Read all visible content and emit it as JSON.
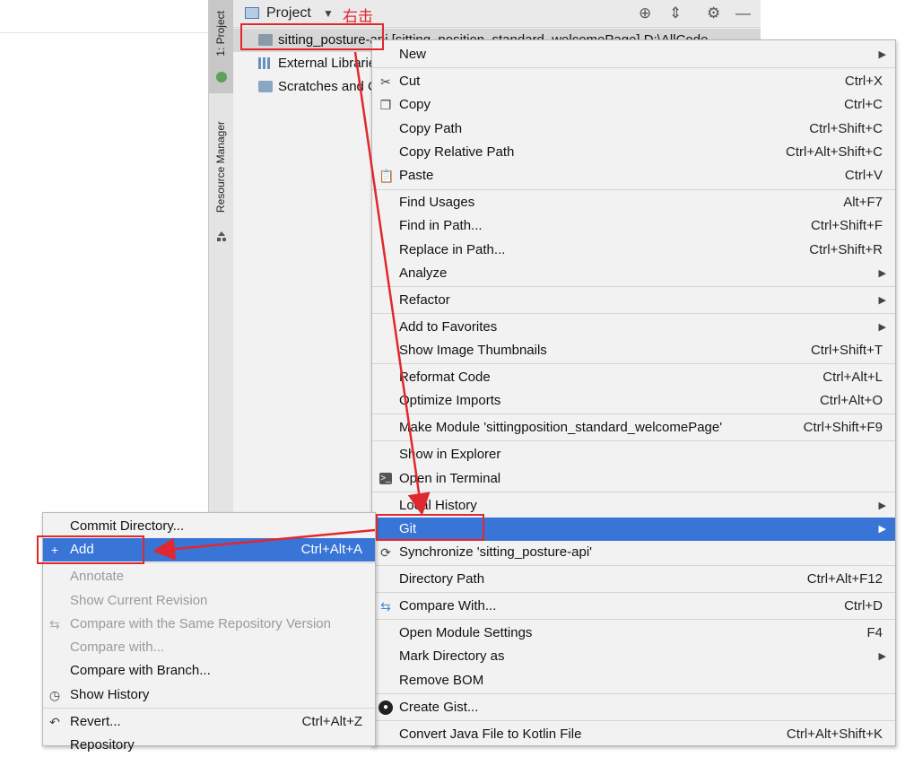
{
  "tool_strip": {
    "project_tab": "1: Project",
    "resource_tab": "Resource Manager"
  },
  "project_panel": {
    "title": "Project",
    "annotation": "右击",
    "tree": [
      {
        "label": "sitting_posture-api [sitting_position_standard_welcomePage]  D:\\AllCode",
        "icon": "module-folder-icon"
      },
      {
        "label": "External Libraries",
        "icon": "library-icon"
      },
      {
        "label": "Scratches and Consoles",
        "icon": "scratches-icon"
      }
    ]
  },
  "context_menu": {
    "items": [
      {
        "label": "New",
        "submenu": true
      },
      {
        "label": "Cut",
        "shortcut": "Ctrl+X",
        "icon": "scissors-icon"
      },
      {
        "label": "Copy",
        "shortcut": "Ctrl+C",
        "icon": "copy-icon"
      },
      {
        "label": "Copy Path",
        "shortcut": "Ctrl+Shift+C"
      },
      {
        "label": "Copy Relative Path",
        "shortcut": "Ctrl+Alt+Shift+C"
      },
      {
        "label": "Paste",
        "shortcut": "Ctrl+V",
        "icon": "paste-icon"
      },
      {
        "label": "Find Usages",
        "shortcut": "Alt+F7"
      },
      {
        "label": "Find in Path...",
        "shortcut": "Ctrl+Shift+F"
      },
      {
        "label": "Replace in Path...",
        "shortcut": "Ctrl+Shift+R"
      },
      {
        "label": "Analyze",
        "submenu": true
      },
      {
        "label": "Refactor",
        "submenu": true
      },
      {
        "label": "Add to Favorites",
        "submenu": true
      },
      {
        "label": "Show Image Thumbnails",
        "shortcut": "Ctrl+Shift+T"
      },
      {
        "label": "Reformat Code",
        "shortcut": "Ctrl+Alt+L"
      },
      {
        "label": "Optimize Imports",
        "shortcut": "Ctrl+Alt+O"
      },
      {
        "label": "Make Module 'sittingposition_standard_welcomePage'",
        "shortcut": "Ctrl+Shift+F9"
      },
      {
        "label": "Show in Explorer"
      },
      {
        "label": "Open in Terminal",
        "icon": "terminal-icon"
      },
      {
        "label": "Local History",
        "submenu": true
      },
      {
        "label": "Git",
        "submenu": true,
        "selected": true
      },
      {
        "label": "Synchronize 'sitting_posture-api'",
        "icon": "sync-icon"
      },
      {
        "label": "Directory Path",
        "shortcut": "Ctrl+Alt+F12"
      },
      {
        "label": "Compare With...",
        "shortcut": "Ctrl+D",
        "icon": "compare-icon"
      },
      {
        "label": "Open Module Settings",
        "shortcut": "F4"
      },
      {
        "label": "Mark Directory as",
        "submenu": true
      },
      {
        "label": "Remove BOM"
      },
      {
        "label": "Create Gist...",
        "icon": "github-icon"
      },
      {
        "label": "Convert Java File to Kotlin File",
        "shortcut": "Ctrl+Alt+Shift+K"
      }
    ]
  },
  "git_submenu": {
    "items": [
      {
        "label": "Commit Directory..."
      },
      {
        "label": "Add",
        "shortcut": "Ctrl+Alt+A",
        "selected": true,
        "icon": "plus-icon"
      },
      {
        "label": "Annotate",
        "disabled": true
      },
      {
        "label": "Show Current Revision",
        "disabled": true
      },
      {
        "label": "Compare with the Same Repository Version",
        "disabled": true,
        "icon": "compare-icon"
      },
      {
        "label": "Compare with...",
        "disabled": true
      },
      {
        "label": "Compare with Branch..."
      },
      {
        "label": "Show History",
        "icon": "clock-icon"
      },
      {
        "label": "Revert...",
        "shortcut": "Ctrl+Alt+Z",
        "icon": "revert-icon"
      },
      {
        "label": "Repository",
        "submenu": true
      }
    ]
  },
  "colors": {
    "selection": "#3875d7",
    "annotation_red": "#e0282e"
  }
}
